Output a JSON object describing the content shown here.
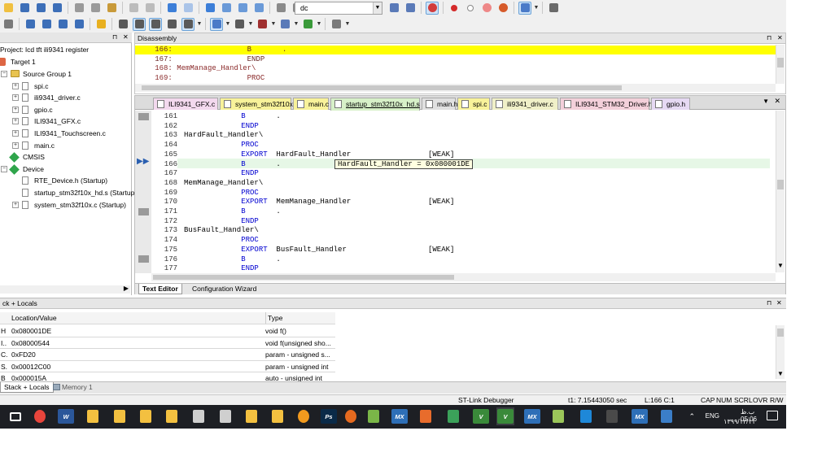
{
  "toolbar": {
    "debug_combo_value": "dc"
  },
  "project_panel": {
    "title": "Project: lcd tft ili9341 register",
    "target": "Target 1",
    "items": [
      {
        "label": "Source Group 1",
        "kind": "folder",
        "indent": 1
      },
      {
        "label": "spi.c",
        "kind": "file",
        "indent": 2
      },
      {
        "label": "ili9341_driver.c",
        "kind": "file",
        "indent": 2
      },
      {
        "label": "gpio.c",
        "kind": "file",
        "indent": 2
      },
      {
        "label": "ILI9341_GFX.c",
        "kind": "file",
        "indent": 2
      },
      {
        "label": "ILI9341_Touchscreen.c",
        "kind": "file",
        "indent": 2
      },
      {
        "label": "main.c",
        "kind": "file",
        "indent": 2
      },
      {
        "label": "CMSIS",
        "kind": "component",
        "indent": 1
      },
      {
        "label": "Device",
        "kind": "component",
        "indent": 1
      },
      {
        "label": "RTE_Device.h (Startup)",
        "kind": "file",
        "indent": 2
      },
      {
        "label": "startup_stm32f10x_hd.s (Startup)",
        "kind": "file",
        "indent": 2
      },
      {
        "label": "system_stm32f10x.c (Startup)",
        "kind": "file",
        "indent": 2
      }
    ]
  },
  "disassembly": {
    "title": "Disassembly",
    "lines": [
      {
        "text": "   166:                 B       .",
        "highlight": true
      },
      {
        "text": "   167:                 ENDP",
        "highlight": false
      },
      {
        "text": "   168: MemManage_Handler\\",
        "highlight": false
      },
      {
        "text": "   169:                 PROC",
        "highlight": false
      }
    ]
  },
  "editor": {
    "tabs": [
      {
        "label": "ILI9341_GFX.c",
        "color": "#f3d9ee"
      },
      {
        "label": "system_stm32f10x.c",
        "color": "#f8f29a"
      },
      {
        "label": "main.c",
        "color": "#f8f29a"
      },
      {
        "label": "startup_stm32f10x_hd.s",
        "color": "#d7f0c8"
      },
      {
        "label": "main.h",
        "color": "#e0e0e0"
      },
      {
        "label": "spi.c",
        "color": "#f8f29a"
      },
      {
        "label": "ili9341_driver.c",
        "color": "#f0f0c8"
      },
      {
        "label": "ILI9341_STM32_Driver.h",
        "color": "#f3d0da"
      },
      {
        "label": "gpio.h",
        "color": "#e6d9f3"
      }
    ],
    "active_tab": 3,
    "lines": [
      {
        "num": "161",
        "label": "",
        "instr": "B",
        "args": "       .",
        "extra": ""
      },
      {
        "num": "162",
        "label": "",
        "instr": "ENDP",
        "args": "",
        "extra": ""
      },
      {
        "num": "163",
        "label": "HardFault_Handler\\",
        "instr": "",
        "args": "",
        "extra": ""
      },
      {
        "num": "164",
        "label": "",
        "instr": "PROC",
        "args": "",
        "extra": ""
      },
      {
        "num": "165",
        "label": "",
        "instr": "EXPORT",
        "args": "  HardFault_Handler",
        "extra": "[WEAK]"
      },
      {
        "num": "166",
        "label": "",
        "instr": "B",
        "args": "       .",
        "extra": ""
      },
      {
        "num": "167",
        "label": "",
        "instr": "ENDP",
        "args": "",
        "extra": ""
      },
      {
        "num": "168",
        "label": "MemManage_Handler\\",
        "instr": "",
        "args": "",
        "extra": ""
      },
      {
        "num": "169",
        "label": "",
        "instr": "PROC",
        "args": "",
        "extra": ""
      },
      {
        "num": "170",
        "label": "",
        "instr": "EXPORT",
        "args": "  MemManage_Handler",
        "extra": "[WEAK]"
      },
      {
        "num": "171",
        "label": "",
        "instr": "B",
        "args": "       .",
        "extra": ""
      },
      {
        "num": "172",
        "label": "",
        "instr": "ENDP",
        "args": "",
        "extra": ""
      },
      {
        "num": "173",
        "label": "BusFault_Handler\\",
        "instr": "",
        "args": "",
        "extra": ""
      },
      {
        "num": "174",
        "label": "",
        "instr": "PROC",
        "args": "",
        "extra": ""
      },
      {
        "num": "175",
        "label": "",
        "instr": "EXPORT",
        "args": "  BusFault_Handler",
        "extra": "[WEAK]"
      },
      {
        "num": "176",
        "label": "",
        "instr": "B",
        "args": "       .",
        "extra": ""
      },
      {
        "num": "177",
        "label": "",
        "instr": "ENDP",
        "args": "",
        "extra": ""
      }
    ],
    "tooltip": "HardFault_Handler = 0x080001DE",
    "bottom_tabs": [
      "Text Editor",
      "Configuration Wizard"
    ]
  },
  "callstack": {
    "title": "ck + Locals",
    "columns": [
      "Location/Value",
      "Type"
    ],
    "rows": [
      {
        "prefix": "H",
        "value": "0x080001DE",
        "type": "void f()"
      },
      {
        "prefix": "I..",
        "value": "0x08000544",
        "type": "void f(unsigned sho..."
      },
      {
        "prefix": "C.",
        "value": "0xFD20",
        "type": "param - unsigned s..."
      },
      {
        "prefix": "S.",
        "value": "0x00012C00",
        "type": "param - unsigned int"
      },
      {
        "prefix": "B",
        "value": "0x000015A",
        "type": "auto - unsigned int"
      }
    ],
    "bottom_tabs": [
      "Stack + Locals",
      "Memory 1"
    ]
  },
  "statusbar": {
    "debugger": "ST-Link Debugger",
    "time": "t1: 7.15443050 sec",
    "position": "L:166 C:1",
    "indicators": [
      "CAP",
      "NUM",
      "SCRL",
      "OVR",
      "R/W"
    ]
  },
  "taskbar": {
    "apps": [
      {
        "name": "mail-icon",
        "label": "",
        "color": "#1d1f24"
      },
      {
        "name": "chrome-icon",
        "label": "",
        "color": "#e8453c"
      },
      {
        "name": "word-icon",
        "label": "W",
        "color": "#2b579a"
      },
      {
        "name": "folder-icon",
        "label": "",
        "color": "#f3c040"
      },
      {
        "name": "folder-icon",
        "label": "",
        "color": "#f3c040"
      },
      {
        "name": "folder-icon",
        "label": "",
        "color": "#f3c040"
      },
      {
        "name": "folder-icon",
        "label": "",
        "color": "#f3c040"
      },
      {
        "name": "drive-icon",
        "label": "",
        "color": "#cfcfcf"
      },
      {
        "name": "drive-icon",
        "label": "",
        "color": "#cfcfcf"
      },
      {
        "name": "folder-icon",
        "label": "",
        "color": "#f3c040"
      },
      {
        "name": "folder-icon",
        "label": "",
        "color": "#f3c040"
      },
      {
        "name": "search-icon",
        "label": "",
        "color": "#f29a1e"
      },
      {
        "name": "photoshop-icon",
        "label": "Ps",
        "color": "#0a2a48"
      },
      {
        "name": "firefox-icon",
        "label": "",
        "color": "#e66a1f"
      },
      {
        "name": "app-icon",
        "label": "",
        "color": "#7ab648"
      },
      {
        "name": "mx-icon",
        "label": "MX",
        "color": "#2e6fb7"
      },
      {
        "name": "app-icon",
        "label": "",
        "color": "#e86c2c"
      },
      {
        "name": "telegram-icon",
        "label": "",
        "color": "#3ba15a"
      },
      {
        "name": "keil-icon",
        "label": "V",
        "color": "#3a8a3a"
      },
      {
        "name": "keil-icon",
        "label": "V",
        "color": "#3a8a3a"
      },
      {
        "name": "mx-icon",
        "label": "MX",
        "color": "#2e6fb7"
      },
      {
        "name": "notepad-icon",
        "label": "",
        "color": "#9bc65a"
      },
      {
        "name": "gear-icon",
        "label": "",
        "color": "#1e88d8"
      },
      {
        "name": "calculator-icon",
        "label": "",
        "color": "#4a4a4a"
      },
      {
        "name": "mx-icon",
        "label": "MX",
        "color": "#2e6fb7"
      },
      {
        "name": "app-icon",
        "label": "",
        "color": "#3b7ec8"
      }
    ],
    "language": "ENG",
    "time": "ب.ظ 05:06",
    "date": "۱۳۹۹/۱۲/۱۱"
  }
}
